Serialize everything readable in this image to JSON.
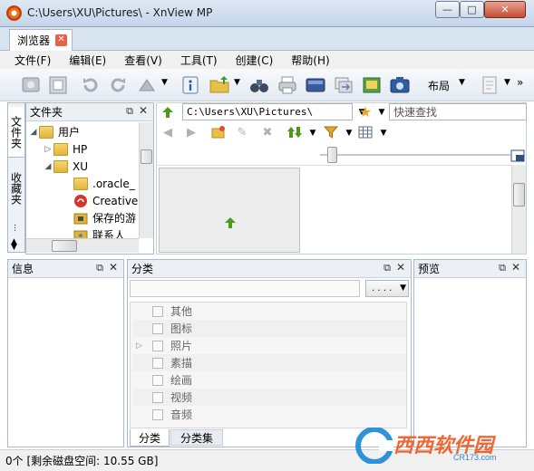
{
  "window": {
    "title": "C:\\Users\\XU\\Pictures\\ - XnView MP",
    "minimize_glyph": "—",
    "maximize_glyph": "□",
    "close_glyph": "✕"
  },
  "tabs": [
    {
      "label": "浏览器"
    }
  ],
  "menu": [
    {
      "label": "文件(F)"
    },
    {
      "label": "编辑(E)"
    },
    {
      "label": "查看(V)"
    },
    {
      "label": "工具(T)"
    },
    {
      "label": "创建(C)"
    },
    {
      "label": "帮助(H)"
    }
  ],
  "toolbar": {
    "layout_label": "布局",
    "more_glyph": "»"
  },
  "side_tabs": [
    {
      "label": "文件夹"
    },
    {
      "label": "收藏夹"
    },
    {
      "label": "..."
    }
  ],
  "folder_panel": {
    "title": "文件夹",
    "tree": [
      {
        "label": "用户",
        "caret": "◢"
      },
      {
        "label": "HP",
        "caret": "▷"
      },
      {
        "label": "XU",
        "caret": "◢"
      },
      {
        "label": ".oracle_"
      },
      {
        "label": "Creative"
      },
      {
        "label": "保存的游"
      },
      {
        "label": "联系人"
      }
    ]
  },
  "address_bar": {
    "path": "C:\\Users\\XU\\Pictures\\",
    "search_placeholder": "快速查找"
  },
  "info_panel": {
    "title": "信息"
  },
  "category_panel": {
    "title": "分类",
    "dropdown_label": ". . . .",
    "items": [
      {
        "label": "其他"
      },
      {
        "label": "图标"
      },
      {
        "label": "照片",
        "expandable": true
      },
      {
        "label": "素描"
      },
      {
        "label": "绘画"
      },
      {
        "label": "视频"
      },
      {
        "label": "音频"
      }
    ],
    "tabs": [
      {
        "label": "分类"
      },
      {
        "label": "分类集"
      }
    ]
  },
  "preview_panel": {
    "title": "预览"
  },
  "status": {
    "text": "0个 [剩余磁盘空间: 10.55 GB]"
  },
  "watermark": {
    "brand": "西西软件园",
    "url": "CR173.com"
  },
  "colors": {
    "titlebar": "#c4d5ea",
    "close_button": "#c44d34",
    "accent_green": "#4a9a1c",
    "folder_yellow": "#e0b43c"
  }
}
